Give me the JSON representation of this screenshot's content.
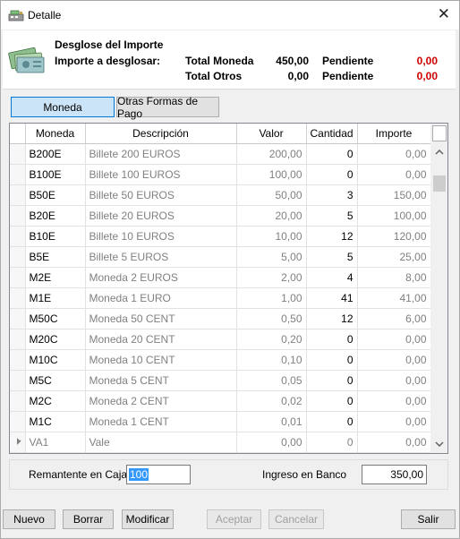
{
  "window": {
    "title": "Detalle",
    "close_glyph": "✕"
  },
  "header": {
    "title": "Desglose del Importe",
    "subtitle": "Importe a desglosar:",
    "total_moneda_label": "Total Moneda",
    "total_moneda_value": "450,00",
    "total_otros_label": "Total Otros",
    "total_otros_value": "0,00",
    "pendiente_label_1": "Pendiente",
    "pendiente_value_1": "0,00",
    "pendiente_label_2": "Pendiente",
    "pendiente_value_2": "0,00",
    "accent_red": "#d00000"
  },
  "tabs": [
    {
      "label": "Moneda",
      "active": true
    },
    {
      "label": "Otras Formas de Pago",
      "active": false
    }
  ],
  "grid": {
    "columns": [
      "Moneda",
      "Descripción",
      "Valor",
      "Cantidad",
      "Importe"
    ],
    "rows": [
      {
        "code": "B200E",
        "desc": "Billete 200 EUROS",
        "valor": "200,00",
        "cantidad": "0",
        "importe": "0,00"
      },
      {
        "code": "B100E",
        "desc": "Billete 100 EUROS",
        "valor": "100,00",
        "cantidad": "0",
        "importe": "0,00"
      },
      {
        "code": "B50E",
        "desc": "Billete 50 EUROS",
        "valor": "50,00",
        "cantidad": "3",
        "importe": "150,00"
      },
      {
        "code": "B20E",
        "desc": "Billete 20 EUROS",
        "valor": "20,00",
        "cantidad": "5",
        "importe": "100,00"
      },
      {
        "code": "B10E",
        "desc": "Billete 10 EUROS",
        "valor": "10,00",
        "cantidad": "12",
        "importe": "120,00"
      },
      {
        "code": "B5E",
        "desc": "Billete 5 EUROS",
        "valor": "5,00",
        "cantidad": "5",
        "importe": "25,00"
      },
      {
        "code": "M2E",
        "desc": "Moneda 2 EUROS",
        "valor": "2,00",
        "cantidad": "4",
        "importe": "8,00"
      },
      {
        "code": "M1E",
        "desc": "Moneda 1 EURO",
        "valor": "1,00",
        "cantidad": "41",
        "importe": "41,00"
      },
      {
        "code": "M50C",
        "desc": "Moneda 50 CENT",
        "valor": "0,50",
        "cantidad": "12",
        "importe": "6,00"
      },
      {
        "code": "M20C",
        "desc": "Moneda 20 CENT",
        "valor": "0,20",
        "cantidad": "0",
        "importe": "0,00"
      },
      {
        "code": "M10C",
        "desc": "Moneda 10 CENT",
        "valor": "0,10",
        "cantidad": "0",
        "importe": "0,00"
      },
      {
        "code": "M5C",
        "desc": "Moneda 5 CENT",
        "valor": "0,05",
        "cantidad": "0",
        "importe": "0,00"
      },
      {
        "code": "M2C",
        "desc": "Moneda 2 CENT",
        "valor": "0,02",
        "cantidad": "0",
        "importe": "0,00"
      },
      {
        "code": "M1C",
        "desc": "Moneda 1 CENT",
        "valor": "0,01",
        "cantidad": "0",
        "importe": "0,00"
      },
      {
        "code": "VA1",
        "desc": "Vale",
        "valor": "0,00",
        "cantidad": "0",
        "importe": "0,00",
        "new_row": true
      }
    ]
  },
  "bottom": {
    "remanente_label": "Remantente en Caja",
    "remanente_value": "100",
    "ingreso_label": "Ingreso en Banco",
    "ingreso_value": "350,00"
  },
  "buttons": {
    "nuevo": "Nuevo",
    "borrar": "Borrar",
    "modificar": "Modificar",
    "aceptar": "Aceptar",
    "cancelar": "Cancelar",
    "salir": "Salir"
  }
}
